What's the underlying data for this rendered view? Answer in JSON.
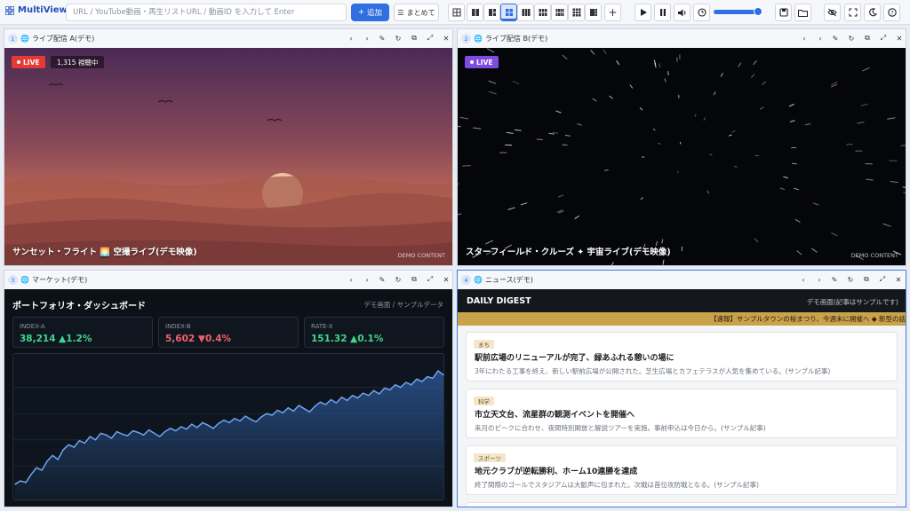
{
  "app": {
    "title": "MultiView"
  },
  "toolbar": {
    "url_placeholder": "URL / YouTube動画・再生リストURL / 動画ID を入力して Enter",
    "add_label": "追加",
    "bulk_label": "まとめて"
  },
  "panels": [
    {
      "num": "1",
      "title": "ライブ配信 A(デモ)",
      "live": "LIVE",
      "viewers": "1,315 視聴中",
      "video_title": "サンセット・フライト 🌅 空撮ライブ(デモ映像)",
      "demo": "DEMO CONTENT"
    },
    {
      "num": "2",
      "title": "ライブ配信 B(デモ)",
      "live": "LIVE",
      "video_title": "スターフィールド・クルーズ ✦ 宇宙ライブ(デモ映像)",
      "demo": "DEMO CONTENT"
    },
    {
      "num": "3",
      "title": "マーケット(デモ)"
    },
    {
      "num": "4",
      "title": "ニュース(デモ)"
    }
  ],
  "dashboard": {
    "title": "ポートフォリオ・ダッシュボード",
    "subtitle": "デモ画面 / サンプルデータ",
    "cards": [
      {
        "label": "INDEX-A",
        "value": "38,214 ▲1.2%",
        "color": "#3fd68a"
      },
      {
        "label": "INDEX-B",
        "value": "5,602 ▼0.4%",
        "color": "#f0616d"
      },
      {
        "label": "RATE-X",
        "value": "151.32 ▲0.1%",
        "color": "#3fd68a"
      }
    ]
  },
  "chart_data": {
    "type": "area",
    "x": [
      0,
      1,
      2,
      3,
      4,
      5,
      6,
      7,
      8,
      9,
      10,
      11,
      12,
      13,
      14,
      15,
      16,
      17,
      18,
      19,
      20,
      21,
      22,
      23,
      24,
      25,
      26,
      27,
      28,
      29,
      30,
      31,
      32,
      33,
      34,
      35,
      36,
      37,
      38,
      39,
      40,
      41,
      42,
      43,
      44,
      45,
      46,
      47,
      48,
      49,
      50,
      51,
      52,
      53,
      54,
      55,
      56,
      57,
      58,
      59,
      60,
      61,
      62,
      63,
      64,
      65,
      66,
      67,
      68,
      69,
      70,
      71,
      72,
      73,
      74,
      75,
      76,
      77,
      78,
      79,
      80
    ],
    "values": [
      10,
      14,
      12,
      22,
      30,
      27,
      38,
      45,
      40,
      52,
      58,
      55,
      63,
      60,
      68,
      64,
      72,
      70,
      66,
      74,
      71,
      69,
      75,
      73,
      70,
      76,
      72,
      68,
      74,
      78,
      75,
      80,
      77,
      83,
      79,
      85,
      82,
      78,
      84,
      88,
      85,
      90,
      87,
      93,
      89,
      86,
      92,
      96,
      94,
      100,
      97,
      103,
      99,
      106,
      102,
      98,
      105,
      110,
      107,
      113,
      109,
      116,
      112,
      118,
      115,
      121,
      118,
      124,
      120,
      127,
      125,
      131,
      128,
      134,
      131,
      138,
      135,
      141,
      139,
      148,
      143
    ],
    "series": [
      {
        "values": [
          10,
          14,
          12,
          22,
          30,
          27,
          38,
          45,
          40,
          52,
          58,
          55,
          63,
          60,
          68,
          64,
          72,
          70,
          66,
          74,
          71,
          69,
          75,
          73,
          70,
          76,
          72,
          68,
          74,
          78,
          75,
          80,
          77,
          83,
          79,
          85,
          82,
          78,
          84,
          88,
          85,
          90,
          87,
          93,
          89,
          86,
          92,
          96,
          94,
          100,
          97,
          103,
          99,
          106,
          102,
          98,
          105,
          110,
          107,
          113,
          109,
          116,
          112,
          118,
          115,
          121,
          118,
          124,
          120,
          127,
          125,
          131,
          128,
          134,
          131,
          138,
          135,
          141,
          139,
          148,
          143
        ]
      }
    ],
    "title": "",
    "xlabel": "",
    "ylabel": "",
    "ylim": [
      0,
      160
    ],
    "grid": true,
    "colors": {
      "line": "#6ea4f2",
      "fill": "#2d5c9e"
    }
  },
  "news": {
    "header": "DAILY DIGEST",
    "header_note": "デモ画面(記事はサンプルです)",
    "ticker": "【速報】サンプルタウンの桜まつり、今週末に開催へ ◆ 新型の話",
    "items": [
      {
        "tag": "まち",
        "headline": "駅前広場のリニューアルが完了、緑あふれる憩いの場に",
        "summary": "3年にわたる工事を終え、新しい駅前広場が公開された。芝生広場とカフェテラスが人気を集めている。(サンプル記事)"
      },
      {
        "tag": "科学",
        "headline": "市立天文台、流星群の観測イベントを開催へ",
        "summary": "来月のピークに合わせ、夜間特別開放と解説ツアーを実施。事前申込は今日から。(サンプル記事)"
      },
      {
        "tag": "スポーツ",
        "headline": "地元クラブが逆転勝利、ホーム10連勝を達成",
        "summary": "終了間際のゴールでスタジアムは大歓声に包まれた。次戦は首位攻防戦となる。(サンプル記事)"
      }
    ]
  },
  "colors": {
    "accent": "#2f6fe0",
    "live_red": "#e53935",
    "live_purple": "#7e4ce0"
  }
}
